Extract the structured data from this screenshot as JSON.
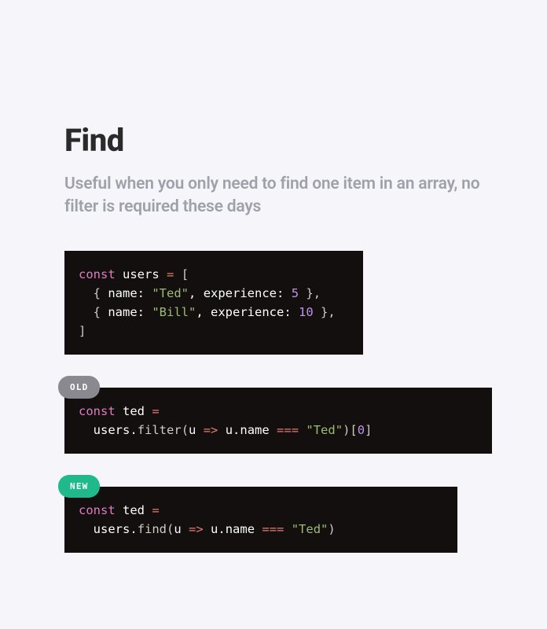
{
  "title": "Find",
  "subtitle": "Useful when you only need to find one item in an array, no filter is required these days",
  "badges": {
    "old": "OLD",
    "new": "NEW"
  },
  "code": {
    "block1": {
      "l1": {
        "const": "const",
        "users": "users",
        "eq": " = ",
        "open": "["
      },
      "l2": {
        "indent": "  ",
        "open": "{ ",
        "nameKey": "name",
        "colon1": ": ",
        "nameVal": "\"Ted\"",
        "comma1": ", ",
        "expKey": "experience",
        "colon2": ": ",
        "expVal": "5",
        "close": " },"
      },
      "l3": {
        "indent": "  ",
        "open": "{ ",
        "nameKey": "name",
        "colon1": ": ",
        "nameVal": "\"Bill\"",
        "comma1": ", ",
        "expKey": "experience",
        "colon2": ": ",
        "expVal": "10",
        "close": " },"
      },
      "l4": {
        "close": "]"
      }
    },
    "block2": {
      "l1": {
        "const": "const",
        "sp": " ",
        "ted": "ted",
        "eq": " ="
      },
      "l2": {
        "indent": "  ",
        "users": "users",
        "dot": ".",
        "filter": "filter",
        "open": "(",
        "u": "u",
        "arrow": " => ",
        "u2": "u",
        "dot2": ".",
        "name": "name",
        "eqeq": " === ",
        "str": "\"Ted\"",
        "close": ")",
        "idx": "[",
        "zero": "0",
        "idx2": "]"
      }
    },
    "block3": {
      "l1": {
        "const": "const",
        "sp": " ",
        "ted": "ted",
        "eq": " ="
      },
      "l2": {
        "indent": "  ",
        "users": "users",
        "dot": ".",
        "find": "find",
        "open": "(",
        "u": "u",
        "arrow": " => ",
        "u2": "u",
        "dot2": ".",
        "name": "name",
        "eqeq": " === ",
        "str": "\"Ted\"",
        "close": ")"
      }
    }
  }
}
